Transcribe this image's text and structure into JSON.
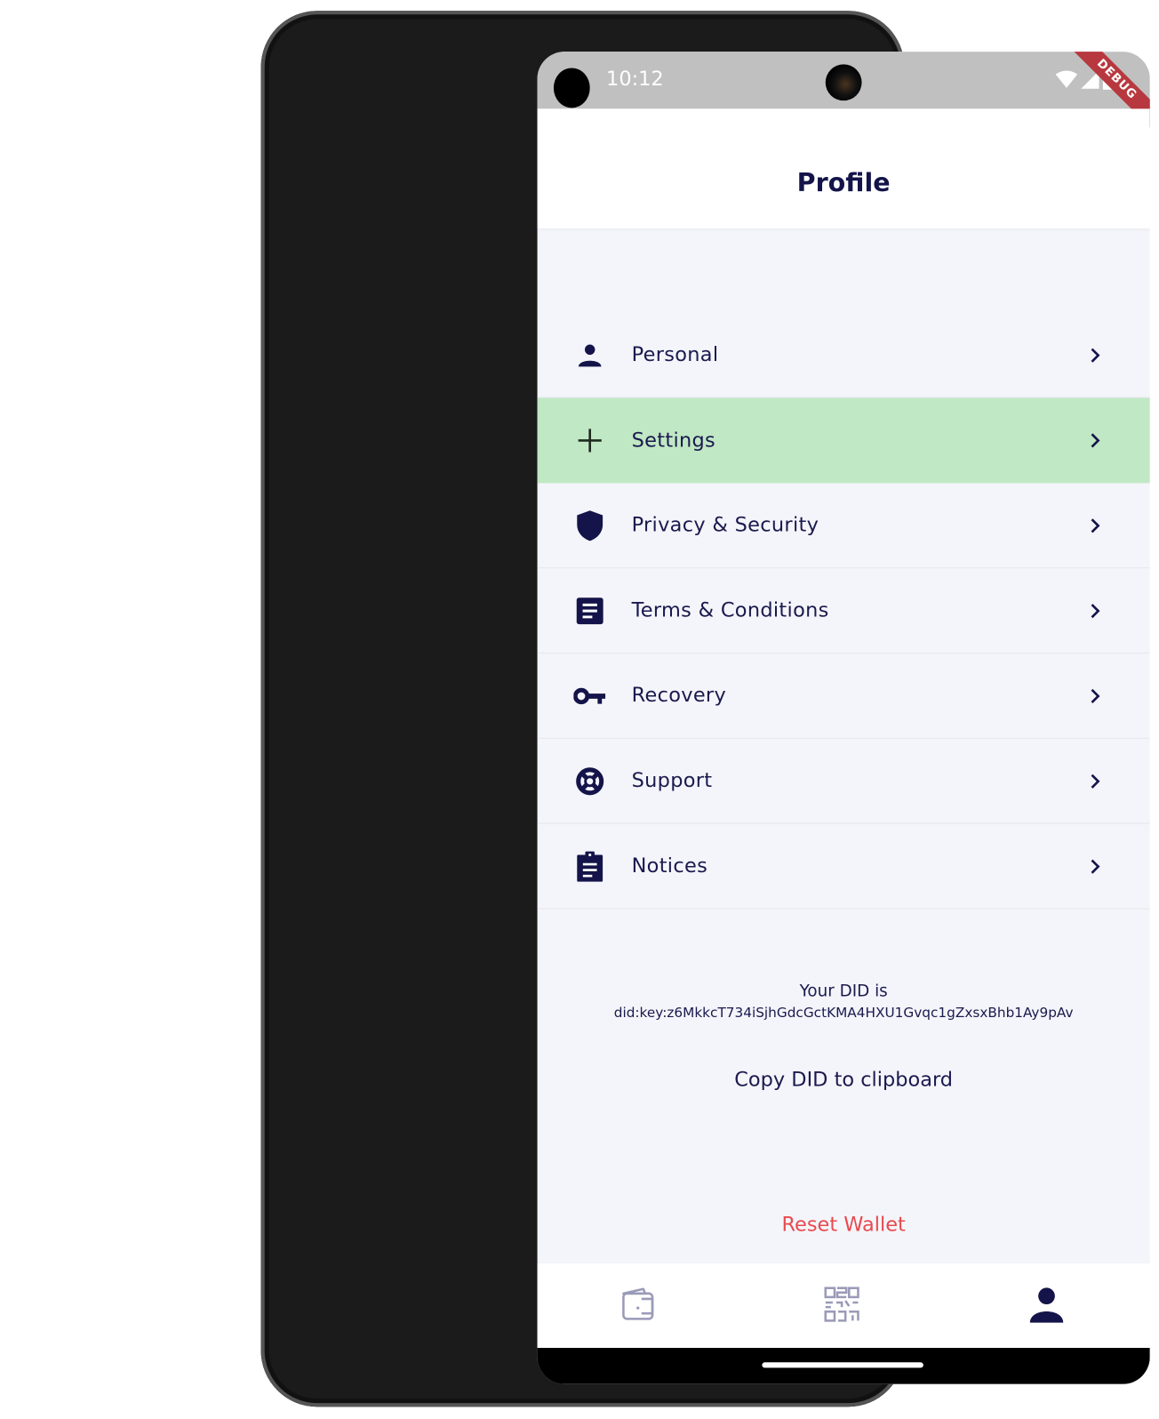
{
  "status_bar": {
    "time": "10:12",
    "debug_banner": "DEBUG",
    "icons": [
      "wifi-icon",
      "signal-icon",
      "battery-icon"
    ]
  },
  "header": {
    "title": "Profile"
  },
  "menu": {
    "items": [
      {
        "label": "Personal",
        "icon": "person-icon",
        "active": false
      },
      {
        "label": "Settings",
        "icon": "plus-icon",
        "active": true
      },
      {
        "label": "Privacy & Security",
        "icon": "shield-icon",
        "active": false
      },
      {
        "label": "Terms & Conditions",
        "icon": "document-icon",
        "active": false
      },
      {
        "label": "Recovery",
        "icon": "key-icon",
        "active": false
      },
      {
        "label": "Support",
        "icon": "lifebuoy-icon",
        "active": false
      },
      {
        "label": "Notices",
        "icon": "clipboard-icon",
        "active": false
      }
    ]
  },
  "did": {
    "label": "Your DID is",
    "value": "did:key:z6MkkcT734iSjhGdcGctKMA4HXU1Gvqc1gZxsxBhb1Ay9pAv",
    "copy_label": "Copy DID to clipboard"
  },
  "reset_label": "Reset Wallet",
  "bottom_nav": {
    "items": [
      {
        "icon": "wallet-icon",
        "active": false
      },
      {
        "icon": "qr-code-icon",
        "active": false
      },
      {
        "icon": "person-icon",
        "active": true
      }
    ]
  },
  "colors": {
    "primary": "#14144a",
    "active_row": "#c0e8c4",
    "danger": "#e84a4f",
    "background": "#f4f5fa",
    "inactive_icon": "#9a9ab8"
  }
}
